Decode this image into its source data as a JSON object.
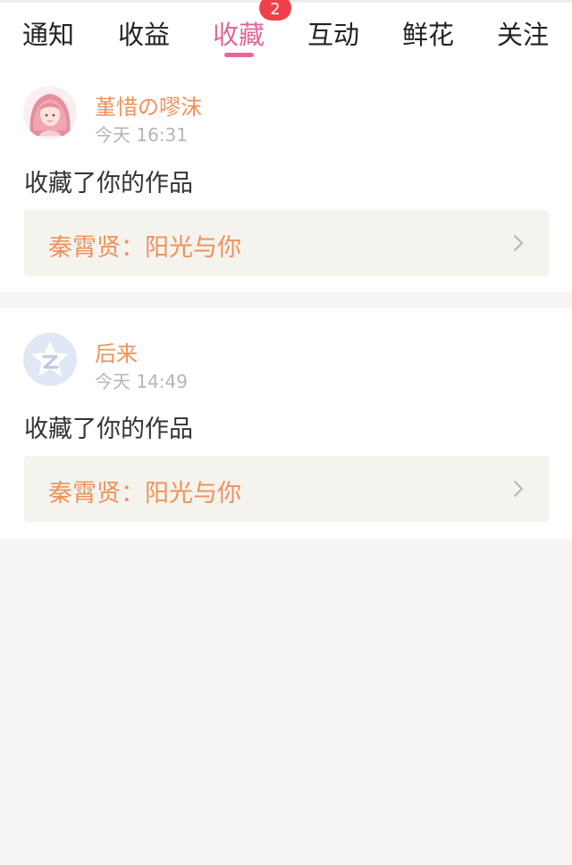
{
  "tabs": [
    {
      "label": "通知"
    },
    {
      "label": "收益"
    },
    {
      "label": "收藏",
      "badge": "2"
    },
    {
      "label": "互动"
    },
    {
      "label": "鲜花"
    },
    {
      "label": "关注"
    }
  ],
  "active_tab": "收藏",
  "colors": {
    "accent": "#e8679a",
    "username": "#f0915a",
    "badge": "#f0414b",
    "work_box": "#f5f3ee",
    "page_bg": "#f7f4f4"
  },
  "notifications": [
    {
      "username": "堇惜の嘐沫",
      "time": "今天 16:31",
      "action": "收藏了你的作品",
      "work": "秦霄贤：阳光与你",
      "avatar": "anime-girl-pink-hair"
    },
    {
      "username": "后来",
      "time": "今天 14:49",
      "action": "收藏了你的作品",
      "work": "秦霄贤：阳光与你",
      "avatar": "qzone-star-default"
    }
  ]
}
